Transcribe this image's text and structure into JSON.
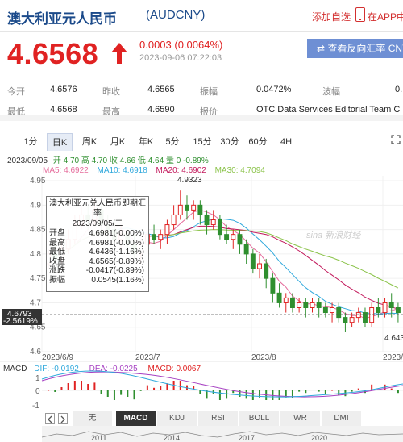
{
  "header": {
    "title": "澳大利亚元人民币",
    "code": "(AUDCNY)",
    "add_favorite": "添加自选",
    "app_label": "在APP中"
  },
  "quote": {
    "price": "4.6568",
    "change": "0.0003 (0.0064%)",
    "timestamp": "2023-09-06 07:22:03",
    "direction": "up",
    "reverse_button": "查看反向汇率 CNY"
  },
  "stats": {
    "open_label": "今开",
    "open": "4.6576",
    "prev_close_label": "昨收",
    "prev_close": "4.6565",
    "amplitude_label": "振幅",
    "amplitude": "0.0472%",
    "wave_label": "波幅",
    "wave": "0.",
    "low_label": "最低",
    "low": "4.6568",
    "high_label": "最高",
    "high": "4.6590",
    "quote_label": "报价",
    "quote_source": "OTC Data Services Editorial Team C"
  },
  "period_tabs": [
    "1分",
    "日K",
    "周K",
    "月K",
    "年K",
    "5分",
    "15分",
    "30分",
    "60分",
    "4H"
  ],
  "active_period": "日K",
  "chart_header": {
    "date": "2023/09/05",
    "ohlc": "开 4.70 高 4.70 收 4.66 低 4.64 量 0 -0.89%",
    "ma5": "MA5: 4.6922",
    "ma10": "MA10: 4.6918",
    "ma20": "MA20: 4.6902",
    "ma30": "MA30: 4.7094"
  },
  "chart_data": {
    "type": "candlestick",
    "y_ticks": [
      "4.95",
      "4.9",
      "4.85",
      "4.8",
      "4.75",
      "4.7",
      "4.65",
      "4.6"
    ],
    "ylim": [
      4.6,
      4.96
    ],
    "x_ticks": [
      "2023/6/9",
      "2023/7",
      "2023/8",
      "2023/"
    ],
    "high_annotation": "4.9323",
    "low_annotation": "4.643",
    "current_price_label": "4.6793",
    "current_pct_label": "-2.5619%",
    "watermark": "sina 新浪财经",
    "colors": {
      "up": "#e02222",
      "down": "#2f8f2f",
      "ma5": "#e56b9b",
      "ma10": "#2fa8dc",
      "ma20": "#c2185b",
      "ma30": "#8bc34a"
    },
    "candles": [
      {
        "o": 4.78,
        "c": 4.8,
        "h": 4.81,
        "l": 4.77
      },
      {
        "o": 4.8,
        "c": 4.79,
        "h": 4.82,
        "l": 4.78
      },
      {
        "o": 4.79,
        "c": 4.81,
        "h": 4.83,
        "l": 4.78
      },
      {
        "o": 4.81,
        "c": 4.83,
        "h": 4.85,
        "l": 4.8
      },
      {
        "o": 4.83,
        "c": 4.86,
        "h": 4.88,
        "l": 4.82
      },
      {
        "o": 4.86,
        "c": 4.88,
        "h": 4.9,
        "l": 4.85
      },
      {
        "o": 4.88,
        "c": 4.87,
        "h": 4.9,
        "l": 4.85
      },
      {
        "o": 4.87,
        "c": 4.89,
        "h": 4.91,
        "l": 4.86
      },
      {
        "o": 4.89,
        "c": 4.86,
        "h": 4.9,
        "l": 4.84
      },
      {
        "o": 4.86,
        "c": 4.85,
        "h": 4.88,
        "l": 4.83
      },
      {
        "o": 4.85,
        "c": 4.83,
        "h": 4.87,
        "l": 4.82
      },
      {
        "o": 4.83,
        "c": 4.84,
        "h": 4.86,
        "l": 4.81
      },
      {
        "o": 4.84,
        "c": 4.82,
        "h": 4.85,
        "l": 4.8
      },
      {
        "o": 4.82,
        "c": 4.8,
        "h": 4.84,
        "l": 4.79
      },
      {
        "o": 4.8,
        "c": 4.82,
        "h": 4.83,
        "l": 4.78
      },
      {
        "o": 4.82,
        "c": 4.84,
        "h": 4.85,
        "l": 4.8
      },
      {
        "o": 4.84,
        "c": 4.83,
        "h": 4.86,
        "l": 4.82
      },
      {
        "o": 4.83,
        "c": 4.84,
        "h": 4.85,
        "l": 4.81
      },
      {
        "o": 4.84,
        "c": 4.86,
        "h": 4.87,
        "l": 4.82
      },
      {
        "o": 4.86,
        "c": 4.88,
        "h": 4.9,
        "l": 4.85
      },
      {
        "o": 4.88,
        "c": 4.9,
        "h": 4.93,
        "l": 4.87
      },
      {
        "o": 4.9,
        "c": 4.89,
        "h": 4.92,
        "l": 4.87
      },
      {
        "o": 4.89,
        "c": 4.9,
        "h": 4.91,
        "l": 4.87
      },
      {
        "o": 4.9,
        "c": 4.88,
        "h": 4.91,
        "l": 4.86
      },
      {
        "o": 4.88,
        "c": 4.86,
        "h": 4.89,
        "l": 4.84
      },
      {
        "o": 4.86,
        "c": 4.87,
        "h": 4.89,
        "l": 4.85
      },
      {
        "o": 4.87,
        "c": 4.84,
        "h": 4.88,
        "l": 4.83
      },
      {
        "o": 4.84,
        "c": 4.83,
        "h": 4.86,
        "l": 4.82
      },
      {
        "o": 4.83,
        "c": 4.84,
        "h": 4.85,
        "l": 4.81
      },
      {
        "o": 4.84,
        "c": 4.82,
        "h": 4.85,
        "l": 4.8
      },
      {
        "o": 4.82,
        "c": 4.8,
        "h": 4.83,
        "l": 4.78
      },
      {
        "o": 4.8,
        "c": 4.77,
        "h": 4.81,
        "l": 4.76
      },
      {
        "o": 4.77,
        "c": 4.78,
        "h": 4.8,
        "l": 4.75
      },
      {
        "o": 4.78,
        "c": 4.75,
        "h": 4.79,
        "l": 4.73
      },
      {
        "o": 4.75,
        "c": 4.72,
        "h": 4.76,
        "l": 4.7
      },
      {
        "o": 4.72,
        "c": 4.7,
        "h": 4.74,
        "l": 4.69
      },
      {
        "o": 4.7,
        "c": 4.71,
        "h": 4.72,
        "l": 4.68
      },
      {
        "o": 4.71,
        "c": 4.69,
        "h": 4.72,
        "l": 4.68
      },
      {
        "o": 4.69,
        "c": 4.7,
        "h": 4.71,
        "l": 4.68
      },
      {
        "o": 4.7,
        "c": 4.69,
        "h": 4.71,
        "l": 4.67
      },
      {
        "o": 4.69,
        "c": 4.7,
        "h": 4.71,
        "l": 4.68
      },
      {
        "o": 4.7,
        "c": 4.69,
        "h": 4.71,
        "l": 4.67
      },
      {
        "o": 4.69,
        "c": 4.68,
        "h": 4.7,
        "l": 4.67
      },
      {
        "o": 4.68,
        "c": 4.69,
        "h": 4.7,
        "l": 4.66
      },
      {
        "o": 4.69,
        "c": 4.67,
        "h": 4.7,
        "l": 4.66
      },
      {
        "o": 4.67,
        "c": 4.66,
        "h": 4.68,
        "l": 4.64
      },
      {
        "o": 4.66,
        "c": 4.67,
        "h": 4.68,
        "l": 4.65
      },
      {
        "o": 4.67,
        "c": 4.68,
        "h": 4.69,
        "l": 4.66
      },
      {
        "o": 4.68,
        "c": 4.66,
        "h": 4.69,
        "l": 4.65
      },
      {
        "o": 4.66,
        "c": 4.69,
        "h": 4.7,
        "l": 4.65
      },
      {
        "o": 4.69,
        "c": 4.68,
        "h": 4.71,
        "l": 4.67
      },
      {
        "o": 4.68,
        "c": 4.7,
        "h": 4.71,
        "l": 4.67
      },
      {
        "o": 4.7,
        "c": 4.69,
        "h": 4.72,
        "l": 4.67
      },
      {
        "o": 4.69,
        "c": 4.68,
        "h": 4.7,
        "l": 4.66
      }
    ]
  },
  "tooltip": {
    "title": "澳大利亚元兑人民币即期汇率",
    "date": "2023/09/05/二",
    "rows": [
      {
        "k": "开盘",
        "v": "4.6981(-0.00%)"
      },
      {
        "k": "最高",
        "v": "4.6981(-0.00%)"
      },
      {
        "k": "最低",
        "v": "4.6436(-1.16%)"
      },
      {
        "k": "收盘",
        "v": "4.6565(-0.89%)"
      },
      {
        "k": "涨跌",
        "v": "-0.0417(-0.89%)"
      },
      {
        "k": "振幅",
        "v": "0.0545(1.16%)"
      }
    ]
  },
  "macd": {
    "label": "MACD",
    "dif": "DIF: -0.0192",
    "dea": "DEA: -0.0225",
    "macd": "MACD: 0.0067",
    "y_ticks": [
      "1",
      "0",
      "-1"
    ]
  },
  "indicator_tabs": [
    "无",
    "MACD",
    "KDJ",
    "RSI",
    "BOLL",
    "WR",
    "DMI"
  ],
  "active_indicator": "MACD",
  "overview_years": [
    "2011",
    "2014",
    "2017",
    "2020"
  ]
}
